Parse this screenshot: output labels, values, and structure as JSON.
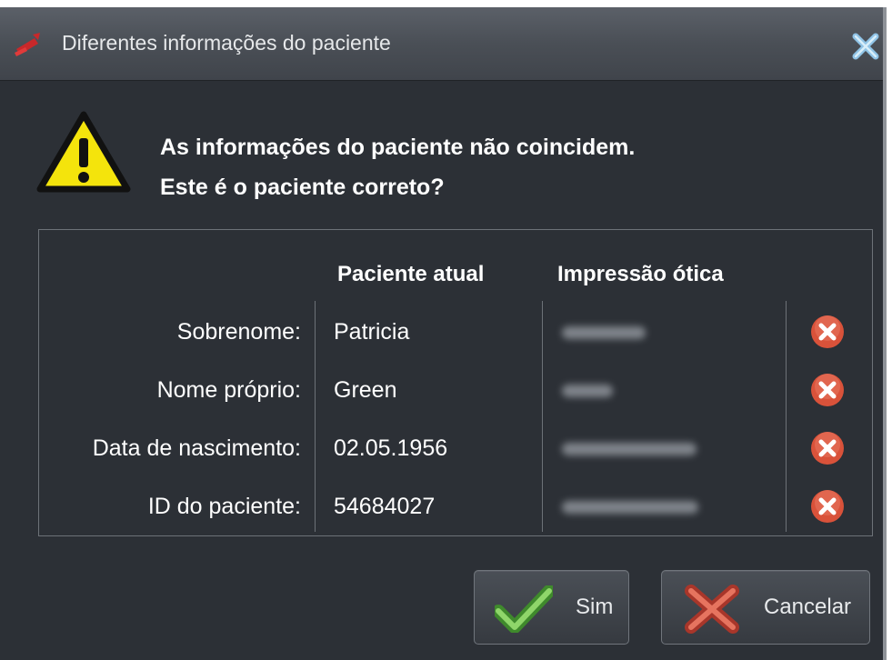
{
  "window": {
    "title": "Diferentes informações do paciente",
    "title_icon": "patient-swap-icon",
    "close_icon": "close-icon"
  },
  "message": {
    "icon": "warning-icon",
    "line1": "As informações do paciente não coincidem.",
    "line2": "Este é o paciente correto?"
  },
  "table": {
    "col_current": "Paciente atual",
    "col_optical": "Impressão ótica",
    "rows": [
      {
        "label": "Sobrenome:",
        "current": "Patricia",
        "status_icon": "mismatch-icon"
      },
      {
        "label": "Nome próprio:",
        "current": "Green",
        "status_icon": "mismatch-icon"
      },
      {
        "label": "Data de nascimento:",
        "current": "02.05.1956",
        "status_icon": "mismatch-icon"
      },
      {
        "label": "ID do paciente:",
        "current": "54684027",
        "status_icon": "mismatch-icon"
      }
    ]
  },
  "buttons": {
    "yes_label": "Sim",
    "yes_icon": "checkmark-icon",
    "cancel_label": "Cancelar",
    "cancel_icon": "cross-icon"
  },
  "colors": {
    "dialog_bg": "#2c3036",
    "warning_yellow": "#f4e40c",
    "error_red": "#d9523a",
    "check_green": "#6cc04a",
    "cross_red": "#c9493a"
  }
}
